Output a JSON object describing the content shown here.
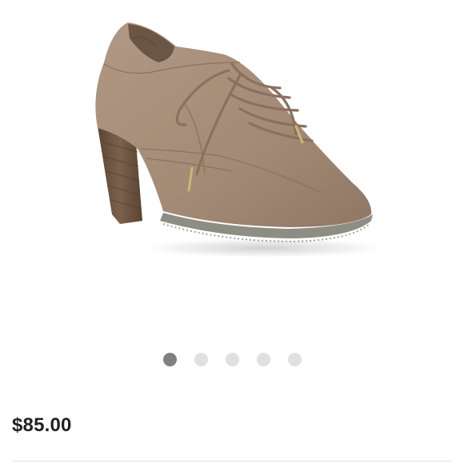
{
  "product": {
    "image_icon": "shoe-image",
    "price": "$85.00"
  },
  "carousel": {
    "count": 5,
    "active_index": 0
  },
  "colors": {
    "suede": "#a38a75",
    "heel": "#6e5644",
    "sole": "#8d8d84",
    "dot_active": "#808080",
    "dot_inactive": "#e0e0e0"
  }
}
